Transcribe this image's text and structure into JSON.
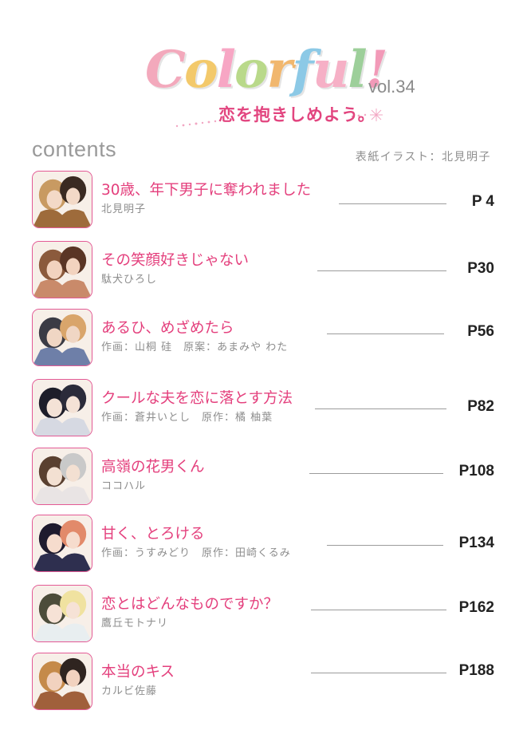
{
  "header": {
    "logo_letters": [
      "C",
      "o",
      "l",
      "o",
      "r",
      "f",
      "u",
      "l",
      "!"
    ],
    "logo_colors": [
      "#f3a9bc",
      "#f3c96b",
      "#f7a6c4",
      "#b9d98a",
      "#f1b76e",
      "#8cc9e6",
      "#f6b0c6",
      "#9dcf9a",
      "#f29ab8"
    ],
    "volume": "vol.34",
    "tagline": "恋を抱きしめよう。",
    "contents_label": "contents",
    "cover_credit": "表紙イラスト：北見明子"
  },
  "theme": {
    "accent": "#e4407d",
    "thumb_border": "#e35a95"
  },
  "entries": [
    {
      "title": "30歳、年下男子に奪われました",
      "author": "北見明子",
      "page": "P 4",
      "palette": [
        "#c89a62",
        "#3a2a22",
        "#f3d9c7",
        "#9e6b3b"
      ]
    },
    {
      "title": "その笑顔好きじゃない",
      "author": "駄犬ひろし",
      "page": "P30",
      "palette": [
        "#8b5a3c",
        "#5a3525",
        "#f2d3bf",
        "#c98a6a"
      ]
    },
    {
      "title": "あるひ、めざめたら",
      "author": "作画：山桐 硅　原案：あまみや わた",
      "page": "P56",
      "palette": [
        "#3b3b45",
        "#d9a56b",
        "#f0d6c4",
        "#6e7fa8"
      ]
    },
    {
      "title": "クールな夫を恋に落とす方法",
      "author": "作画：蒼井いとし　原作：橘 柚葉",
      "page": "P82",
      "palette": [
        "#1e1e2a",
        "#2b2b3a",
        "#f4e2d6",
        "#d6d9e2"
      ]
    },
    {
      "title": "高嶺の花男くん",
      "author": "ココハル",
      "page": "P108",
      "palette": [
        "#5a4030",
        "#c9c9c9",
        "#f3e0d2",
        "#e9e4e4"
      ]
    },
    {
      "title": "甘く、とろける",
      "author": "作画：うすみどり　原作：田崎くるみ",
      "page": "P134",
      "palette": [
        "#1f1b2e",
        "#e28a6a",
        "#f6dccd",
        "#2e2f4f"
      ]
    },
    {
      "title": "恋とはどんなものですか？",
      "author": "鷹丘モトナリ",
      "page": "P162",
      "palette": [
        "#4c4c3a",
        "#f0e2a0",
        "#f6e2d6",
        "#e8eef0"
      ]
    },
    {
      "title": "本当のキス",
      "author": "カルビ佐藤",
      "page": "P188",
      "palette": [
        "#c58a4a",
        "#2f2420",
        "#f2d2bf",
        "#a0603b"
      ]
    }
  ]
}
